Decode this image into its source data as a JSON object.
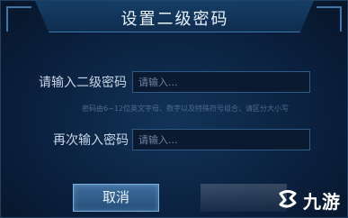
{
  "dialog": {
    "title": "设置二级密码",
    "password_label": "请输入二级密码",
    "password_placeholder": "请输入...",
    "hint": "密码由6~12位英文字母、数字以及特殊符号组合，请区分大小写",
    "confirm_label": "再次输入密码",
    "confirm_placeholder": "请输入...",
    "cancel_label": "取消"
  },
  "watermark": {
    "text": "九游"
  },
  "colors": {
    "background": "#0b2140",
    "accent": "#3c79b2",
    "button": "#2f5f8e"
  },
  "icons": [
    "watermark-logo-icon"
  ]
}
